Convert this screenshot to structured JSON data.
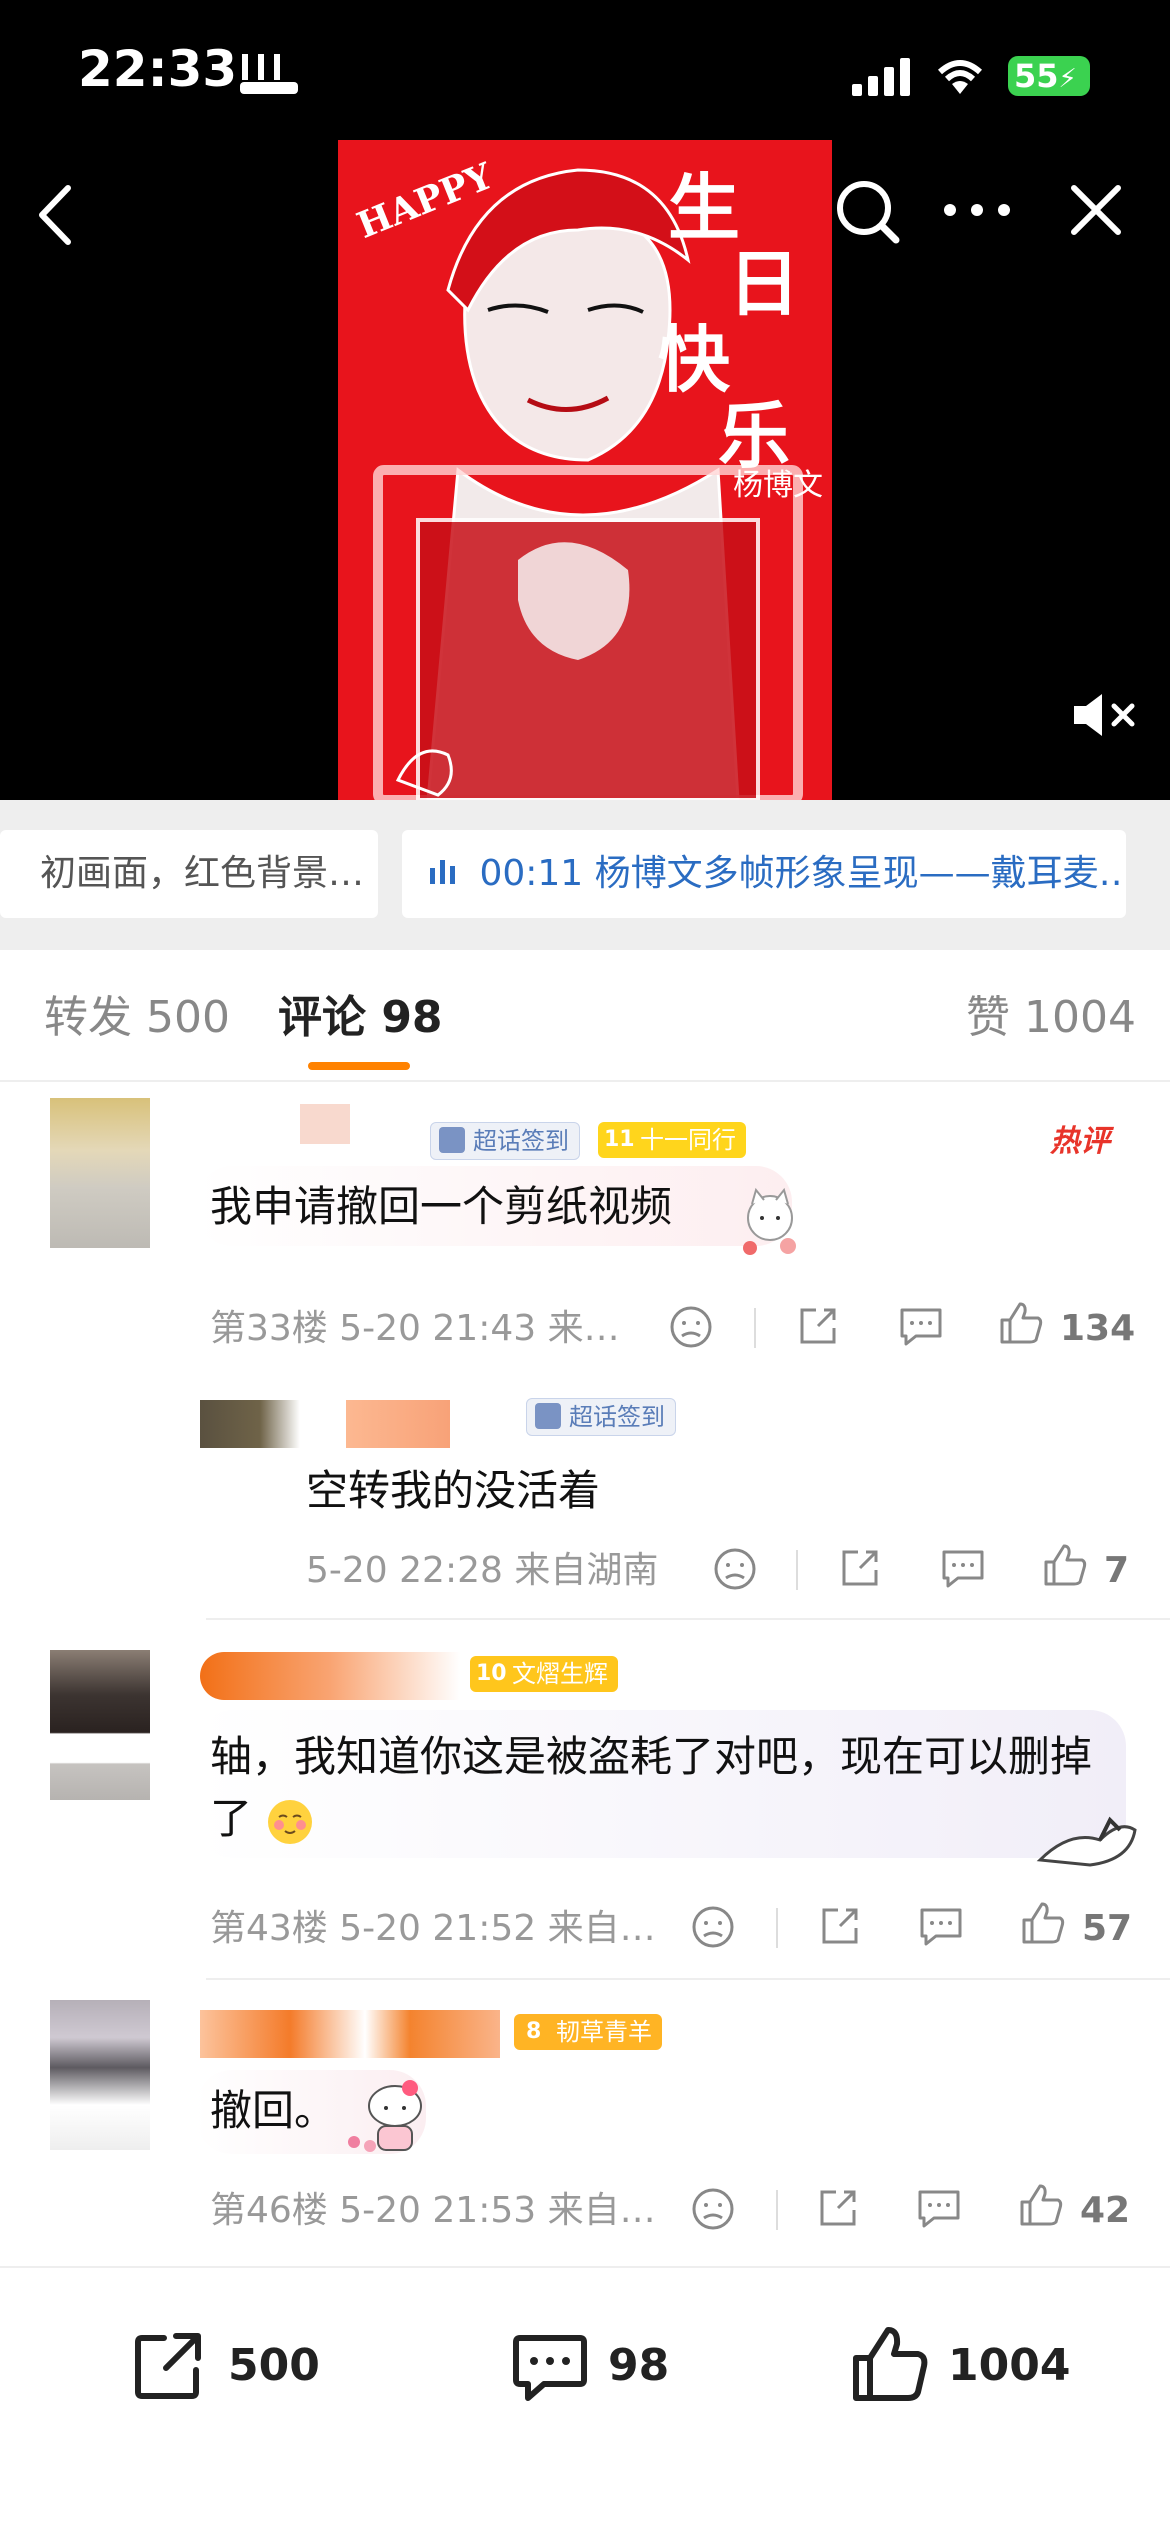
{
  "status": {
    "time": "22:33",
    "battery": "55"
  },
  "video": {
    "poster_title_chars": [
      "生",
      "日",
      "快",
      "乐"
    ],
    "poster_name": "杨博文",
    "poster_happy": "HAPPY"
  },
  "chips": [
    {
      "text": "初画面，红色背景…"
    },
    {
      "text": "00:11 杨博文多帧形象呈现——戴耳麦…"
    }
  ],
  "tabs": {
    "repost": "转发 500",
    "comments": "评论 98",
    "likes": "赞 1004"
  },
  "comments": [
    {
      "badges": [
        "超话签到",
        "十一同行"
      ],
      "badge_level": "11",
      "hot": "热评",
      "text": "我申请撤回一个剪纸视频",
      "meta": "第33楼  5-20 21:43  来…",
      "likes": "134"
    },
    {
      "badges": [
        "超话签到"
      ],
      "text": "空转我的没活着",
      "meta": "5-20 22:28  来自湖南",
      "likes": "7"
    },
    {
      "badges": [
        "文熠生辉"
      ],
      "badge_level": "10",
      "text": "轴，我知道你这是被盗耗了对吧，现在可以删掉了",
      "meta": "第43楼  5-20 21:52  来自…",
      "likes": "57"
    },
    {
      "badges": [
        "韧草青羊"
      ],
      "badge_level": "8",
      "text": "撤回。",
      "meta": "第46楼  5-20 21:53  来自…",
      "likes": "42"
    }
  ],
  "bottom": {
    "repost": "500",
    "comments": "98",
    "likes": "1004"
  },
  "colors": {
    "accent": "#ff8200",
    "poster_red": "#e8141c",
    "badge_blue": "#5a7db8"
  }
}
